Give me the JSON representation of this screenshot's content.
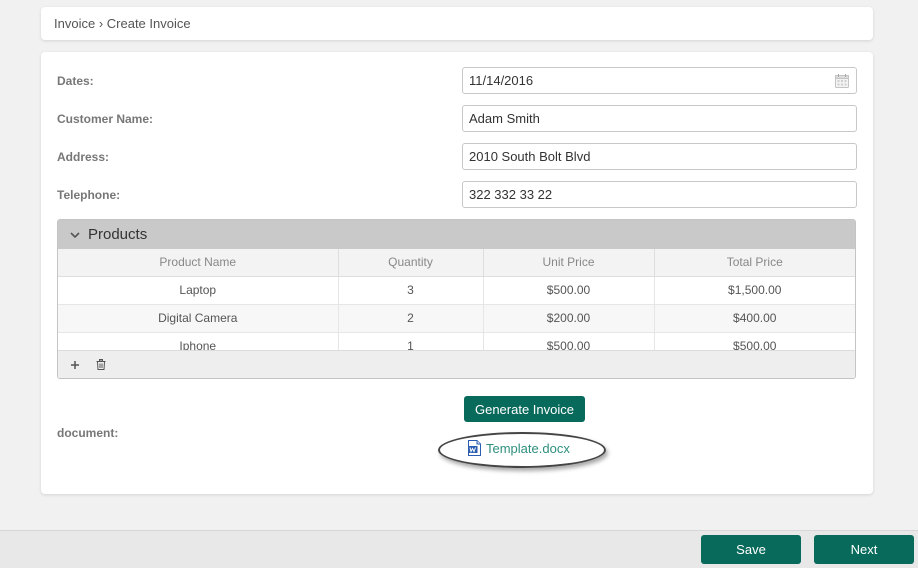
{
  "breadcrumb": {
    "parent": "Invoice",
    "separator": " › ",
    "current": "Create Invoice"
  },
  "form": {
    "dates_label": "Dates:",
    "dates_value": "11/14/2016",
    "customer_label": "Customer Name:",
    "customer_value": "Adam Smith",
    "address_label": "Address:",
    "address_value": "2010 South Bolt Blvd",
    "telephone_label": "Telephone:",
    "telephone_value": "322 332 33 22"
  },
  "products": {
    "title": "Products",
    "columns": [
      "Product Name",
      "Quantity",
      "Unit Price",
      "Total Price"
    ],
    "rows": [
      [
        "Laptop",
        "3",
        "$500.00",
        "$1,500.00"
      ],
      [
        "Digital Camera",
        "2",
        "$200.00",
        "$400.00"
      ],
      [
        "Iphone",
        "1",
        "$500.00",
        "$500.00"
      ]
    ],
    "toolbar_icons": [
      "plus-icon",
      "trash-icon"
    ]
  },
  "document": {
    "label": "document:",
    "generate_label": "Generate Invoice",
    "file_name": "Template.docx",
    "file_icon": "word-document-icon"
  },
  "footer": {
    "save_label": "Save",
    "next_label": "Next"
  },
  "colors": {
    "accent": "#086a5b",
    "link": "#2e8f7d",
    "panel_header": "#c9c9c9"
  }
}
